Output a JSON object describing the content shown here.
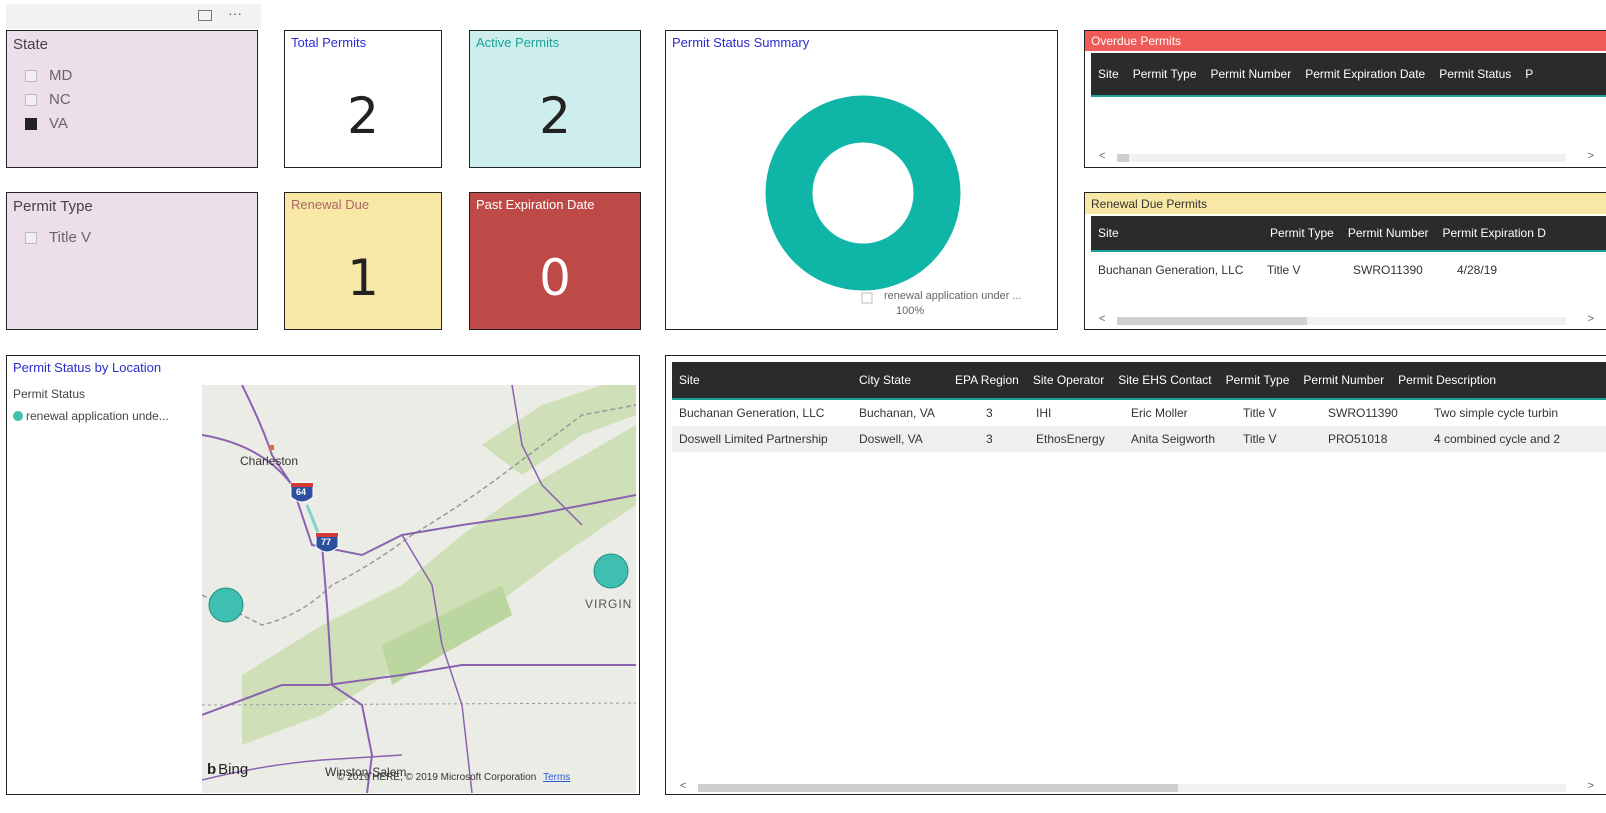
{
  "toolbar": {
    "focus_icon": "focus-mode-icon",
    "more_label": "···"
  },
  "state_slicer": {
    "title": "State",
    "options": [
      {
        "label": "MD",
        "checked": false
      },
      {
        "label": "NC",
        "checked": false
      },
      {
        "label": "VA",
        "checked": true
      }
    ]
  },
  "permit_type_slicer": {
    "title": "Permit Type",
    "options": [
      {
        "label": "Title V",
        "checked": false
      }
    ]
  },
  "cards": {
    "total": {
      "title": "Total Permits",
      "value": "2"
    },
    "active": {
      "title": "Active Permits",
      "value": "2"
    },
    "renewal": {
      "title": "Renewal Due",
      "value": "1"
    },
    "past": {
      "title": "Past Expiration Date",
      "value": "0"
    }
  },
  "summary": {
    "title": "Permit Status Summary",
    "legend_label": "renewal application under ...",
    "legend_pct": "100%",
    "color": "#0fb5a6"
  },
  "chart_data": {
    "type": "pie",
    "title": "Permit Status Summary",
    "categories": [
      "renewal application under ..."
    ],
    "values": [
      100
    ],
    "colors": [
      "#0fb5a6"
    ]
  },
  "overdue": {
    "title": "Overdue Permits",
    "header_color": "#f05b58",
    "columns": [
      "Site",
      "Permit Type",
      "Permit Number",
      "Permit Expiration Date",
      "Permit Status",
      "P"
    ]
  },
  "renewal_table": {
    "title": "Renewal Due Permits",
    "header_color": "#f8e8a6",
    "columns": [
      "Site",
      "Permit Type",
      "Permit Number",
      "Permit Expiration D"
    ],
    "rows": [
      [
        "Buchanan Generation, LLC",
        "Title V",
        "SWRO11390",
        "4/28/19"
      ]
    ]
  },
  "map": {
    "title": "Permit Status by Location",
    "legend_title": "Permit Status",
    "legend_item": "renewal application unde...",
    "labels": {
      "charleston": "Charleston",
      "virginia": "VIRGIN",
      "i64": "64",
      "i77": "77",
      "winston": "Winston-Salem"
    },
    "bing": "Bing",
    "copyright": "© 2019 HERE, © 2019 Microsoft Corporation",
    "terms": "Terms"
  },
  "main_table": {
    "columns": [
      "Site",
      "City State",
      "EPA Region",
      "Site Operator",
      "Site EHS Contact",
      "Permit Type",
      "Permit Number",
      "Permit Description"
    ],
    "rows": [
      [
        "Buchanan Generation, LLC",
        "Buchanan, VA",
        "3",
        "IHI",
        "Eric Moller",
        "Title V",
        "SWRO11390",
        "Two simple cycle turbin"
      ],
      [
        "Doswell Limited Partnership",
        "Doswell, VA",
        "3",
        "EthosEnergy",
        "Anita Seigworth",
        "Title V",
        "PRO51018",
        "4 combined cycle and 2"
      ]
    ]
  }
}
